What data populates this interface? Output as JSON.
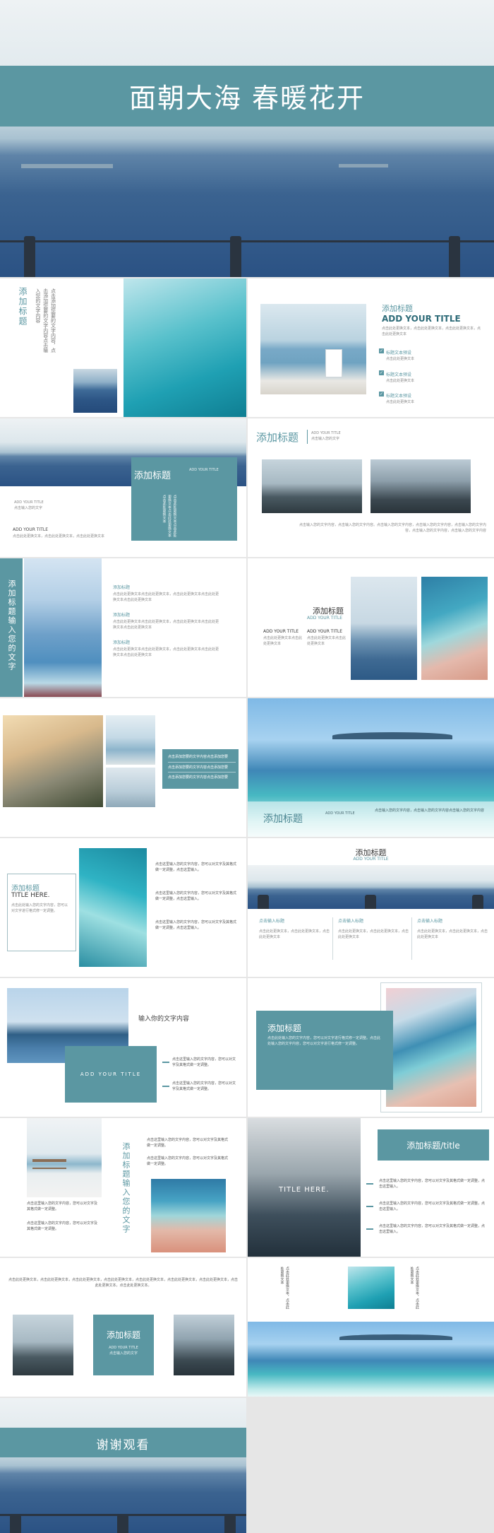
{
  "cover": {
    "title": "面朝大海 春暖花开"
  },
  "s2": {
    "title": "添加标题",
    "body": "点击添加您要的文字内容，点击添加您要的文字内容点击输入您的文字内容"
  },
  "s3": {
    "title_cn": "添加标题",
    "title_en": "ADD YOUR TITLE",
    "intro": "点击此处更换文本，点击此处更换文本，点击此处更换文本，点击此处更换文本",
    "items": [
      {
        "label": "标题文本预设",
        "desc": "点击此处更换文本"
      },
      {
        "label": "标题文本预设",
        "desc": "点击此处更换文本"
      },
      {
        "label": "标题文本预设",
        "desc": "点击此处更换文本"
      }
    ]
  },
  "s4": {
    "title": "添加标题",
    "sub": "ADD YOUR TITLE",
    "left_en": "ADD YOUR TITLE",
    "left_cn": "点击输入您的文字",
    "left_title": "ADD YOUR TITLE",
    "left_body": "点击此处更换文本，点击此处更换文本，点击此处更换文本",
    "vertical_text": "点击此处更换文本点击此处更换文本点击此处更换文本点击此处更换文本"
  },
  "s5": {
    "title": "添加标题",
    "sub1": "ADD YOUR TITLE",
    "sub2": "点击输入您的文字",
    "body": "点击输入您的文字内容，点击输入您的文字内容。点击输入您的文字内容，点击输入您的文字内容，点击输入您的文字内容，点击输入您的文字内容，点击输入您的文字内容"
  },
  "s6": {
    "vertical_title": "添加标题输入您的文字",
    "items": [
      {
        "title": "添加标题",
        "body": "点击此处更换文本点击此处更换文本，点击此处更换文本点击此处更换文本点击此处更换文本"
      },
      {
        "title": "添加标题",
        "body": "点击此处更换文本点击此处更换文本，点击此处更换文本点击此处更换文本点击此处更换文本"
      },
      {
        "title": "添加标题",
        "body": "点击此处更换文本点击此处更换文本，点击此处更换文本点击此处更换文本点击此处更换文本"
      }
    ]
  },
  "s7": {
    "title": "添加标题",
    "sub": "ADD YOUR TITLE",
    "col1_title": "ADD YOUR TITLE",
    "col1_body": "点击此处更换文本点击此处更换文本",
    "col2_title": "ADD YOUR TITLE",
    "col2_body": "点击此处更换文本点击此处更换文本"
  },
  "s8": {
    "lines": [
      "点击添加您要的文字内容点击添加您要",
      "点击添加您要的文字内容点击添加您要",
      "点击添加您要的文字内容点击添加您要"
    ]
  },
  "s9": {
    "title": "添加标题",
    "sub": "ADD YOUR TITLE",
    "body": "点击输入您的文字内容，点击输入您的文字内容点击输入您的文字内容"
  },
  "s10": {
    "title_cn": "添加标题",
    "title_en": "TITLE HERE.",
    "body": "点击此处输入您的文字内容，您可以对文字进行格式修一定调整。",
    "items": [
      "点击这里输入您的文字内容，您可以对文字及其格式做一定调整，点击这里输入。",
      "点击这里输入您的文字内容，您可以对文字及其格式做一定调整，点击这里输入。",
      "点击这里输入您的文字内容，您可以对文字及其格式做一定调整，点击这里输入。"
    ]
  },
  "s11": {
    "title": "添加标题",
    "sub": "ADD YOUR TITLE",
    "cols": [
      {
        "title": "点击输入标题",
        "body": "点击此处更换文本，点击此处更换文本，点击此处更换文本"
      },
      {
        "title": "点击输入标题",
        "body": "点击此处更换文本，点击此处更换文本，点击此处更换文本"
      },
      {
        "title": "点击输入标题",
        "body": "点击此处更换文本，点击此处更换文本，点击此处更换文本"
      }
    ]
  },
  "s12": {
    "heading": "输入你的文字内容",
    "box": "ADD YOUR TITLE",
    "items": [
      "点击这里输入您的文字内容，您可以对文字及其格式做一定调整。",
      "点击这里输入您的文字内容，您可以对文字及其格式做一定调整。"
    ]
  },
  "s13": {
    "title": "添加标题",
    "body": "点击此处输入您的文字内容，您可以对文字进行格式修一定调整。点击此处输入您的文字内容，您可以对文字进行格式修一定调整。"
  },
  "s14": {
    "vertical_title": "添加标题输入您的文字",
    "top": [
      "点击这里输入您的文字内容，您可以对文字及其格式做一定调整。",
      "点击这里输入您的文字内容，您可以对文字及其格式做一定调整。"
    ],
    "left": [
      "点击这里输入您的文字内容，您可以对文字及其格式做一定调整。",
      "点击这里输入您的文字内容，您可以对文字及其格式做一定调整。"
    ]
  },
  "s15": {
    "title": "添加标题/title",
    "img_text": "TITLE HERE.",
    "items": [
      "点击这里输入您的文字内容，您可以对文字及其格式做一定调整，点击这里输入。",
      "点击这里输入您的文字内容，您可以对文字及其格式做一定调整，点击这里输入。",
      "点击这里输入您的文字内容，您可以对文字及其格式做一定调整，点击这里输入。"
    ]
  },
  "s16": {
    "top_text": "点击此处更换文本，点击此处更换文本，点击此处更换文本，点击此处更换文本，点击此处更换文本，点击此处更换文本，点击此处更换文本，点击此处更换文本，点击此处更换文本。",
    "title": "添加标题",
    "sub1": "ADD YOUR TITLE",
    "sub2": "点击输入您的文字"
  },
  "s17": {
    "left_vertical": "点击此处更换文本，点击此处更换文本",
    "right_vertical": "点击此处更换文本，点击此处更换文本"
  },
  "end": {
    "title": "谢谢观看"
  }
}
